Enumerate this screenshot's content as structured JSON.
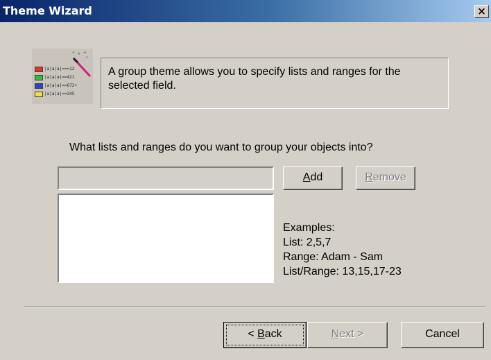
{
  "window": {
    "title": "Theme Wizard",
    "close_glyph": "×"
  },
  "icon": {
    "name": "theme-wizard-icon",
    "rows": [
      {
        "text": "|a|a|a|===12",
        "color": "#e03030"
      },
      {
        "text": "|a|a|a|==421",
        "color": "#30c030"
      },
      {
        "text": "|a|a|a|==672+",
        "color": "#3040d0"
      },
      {
        "text": "|a|a|a|==345",
        "color": "#f0e040"
      }
    ]
  },
  "info": {
    "line1": "A group theme allows you to specify lists and ranges for the",
    "line2": "selected field."
  },
  "question": "What lists and ranges do you want to group your objects into?",
  "range_input": {
    "value": ""
  },
  "buttons": {
    "add_prefix": "",
    "add_hotkey": "A",
    "add_rest": "dd",
    "remove_hotkey": "R",
    "remove_rest": "emove",
    "back_prefix": "< ",
    "back_hotkey": "B",
    "back_rest": "ack",
    "next_hotkey": "N",
    "next_rest": "ext >",
    "cancel_label": "Cancel"
  },
  "examples": {
    "heading": "Examples:",
    "list": "List:  2,5,7",
    "range": "Range:  Adam - Sam",
    "list_range": "List/Range:  13,15,17-23"
  }
}
